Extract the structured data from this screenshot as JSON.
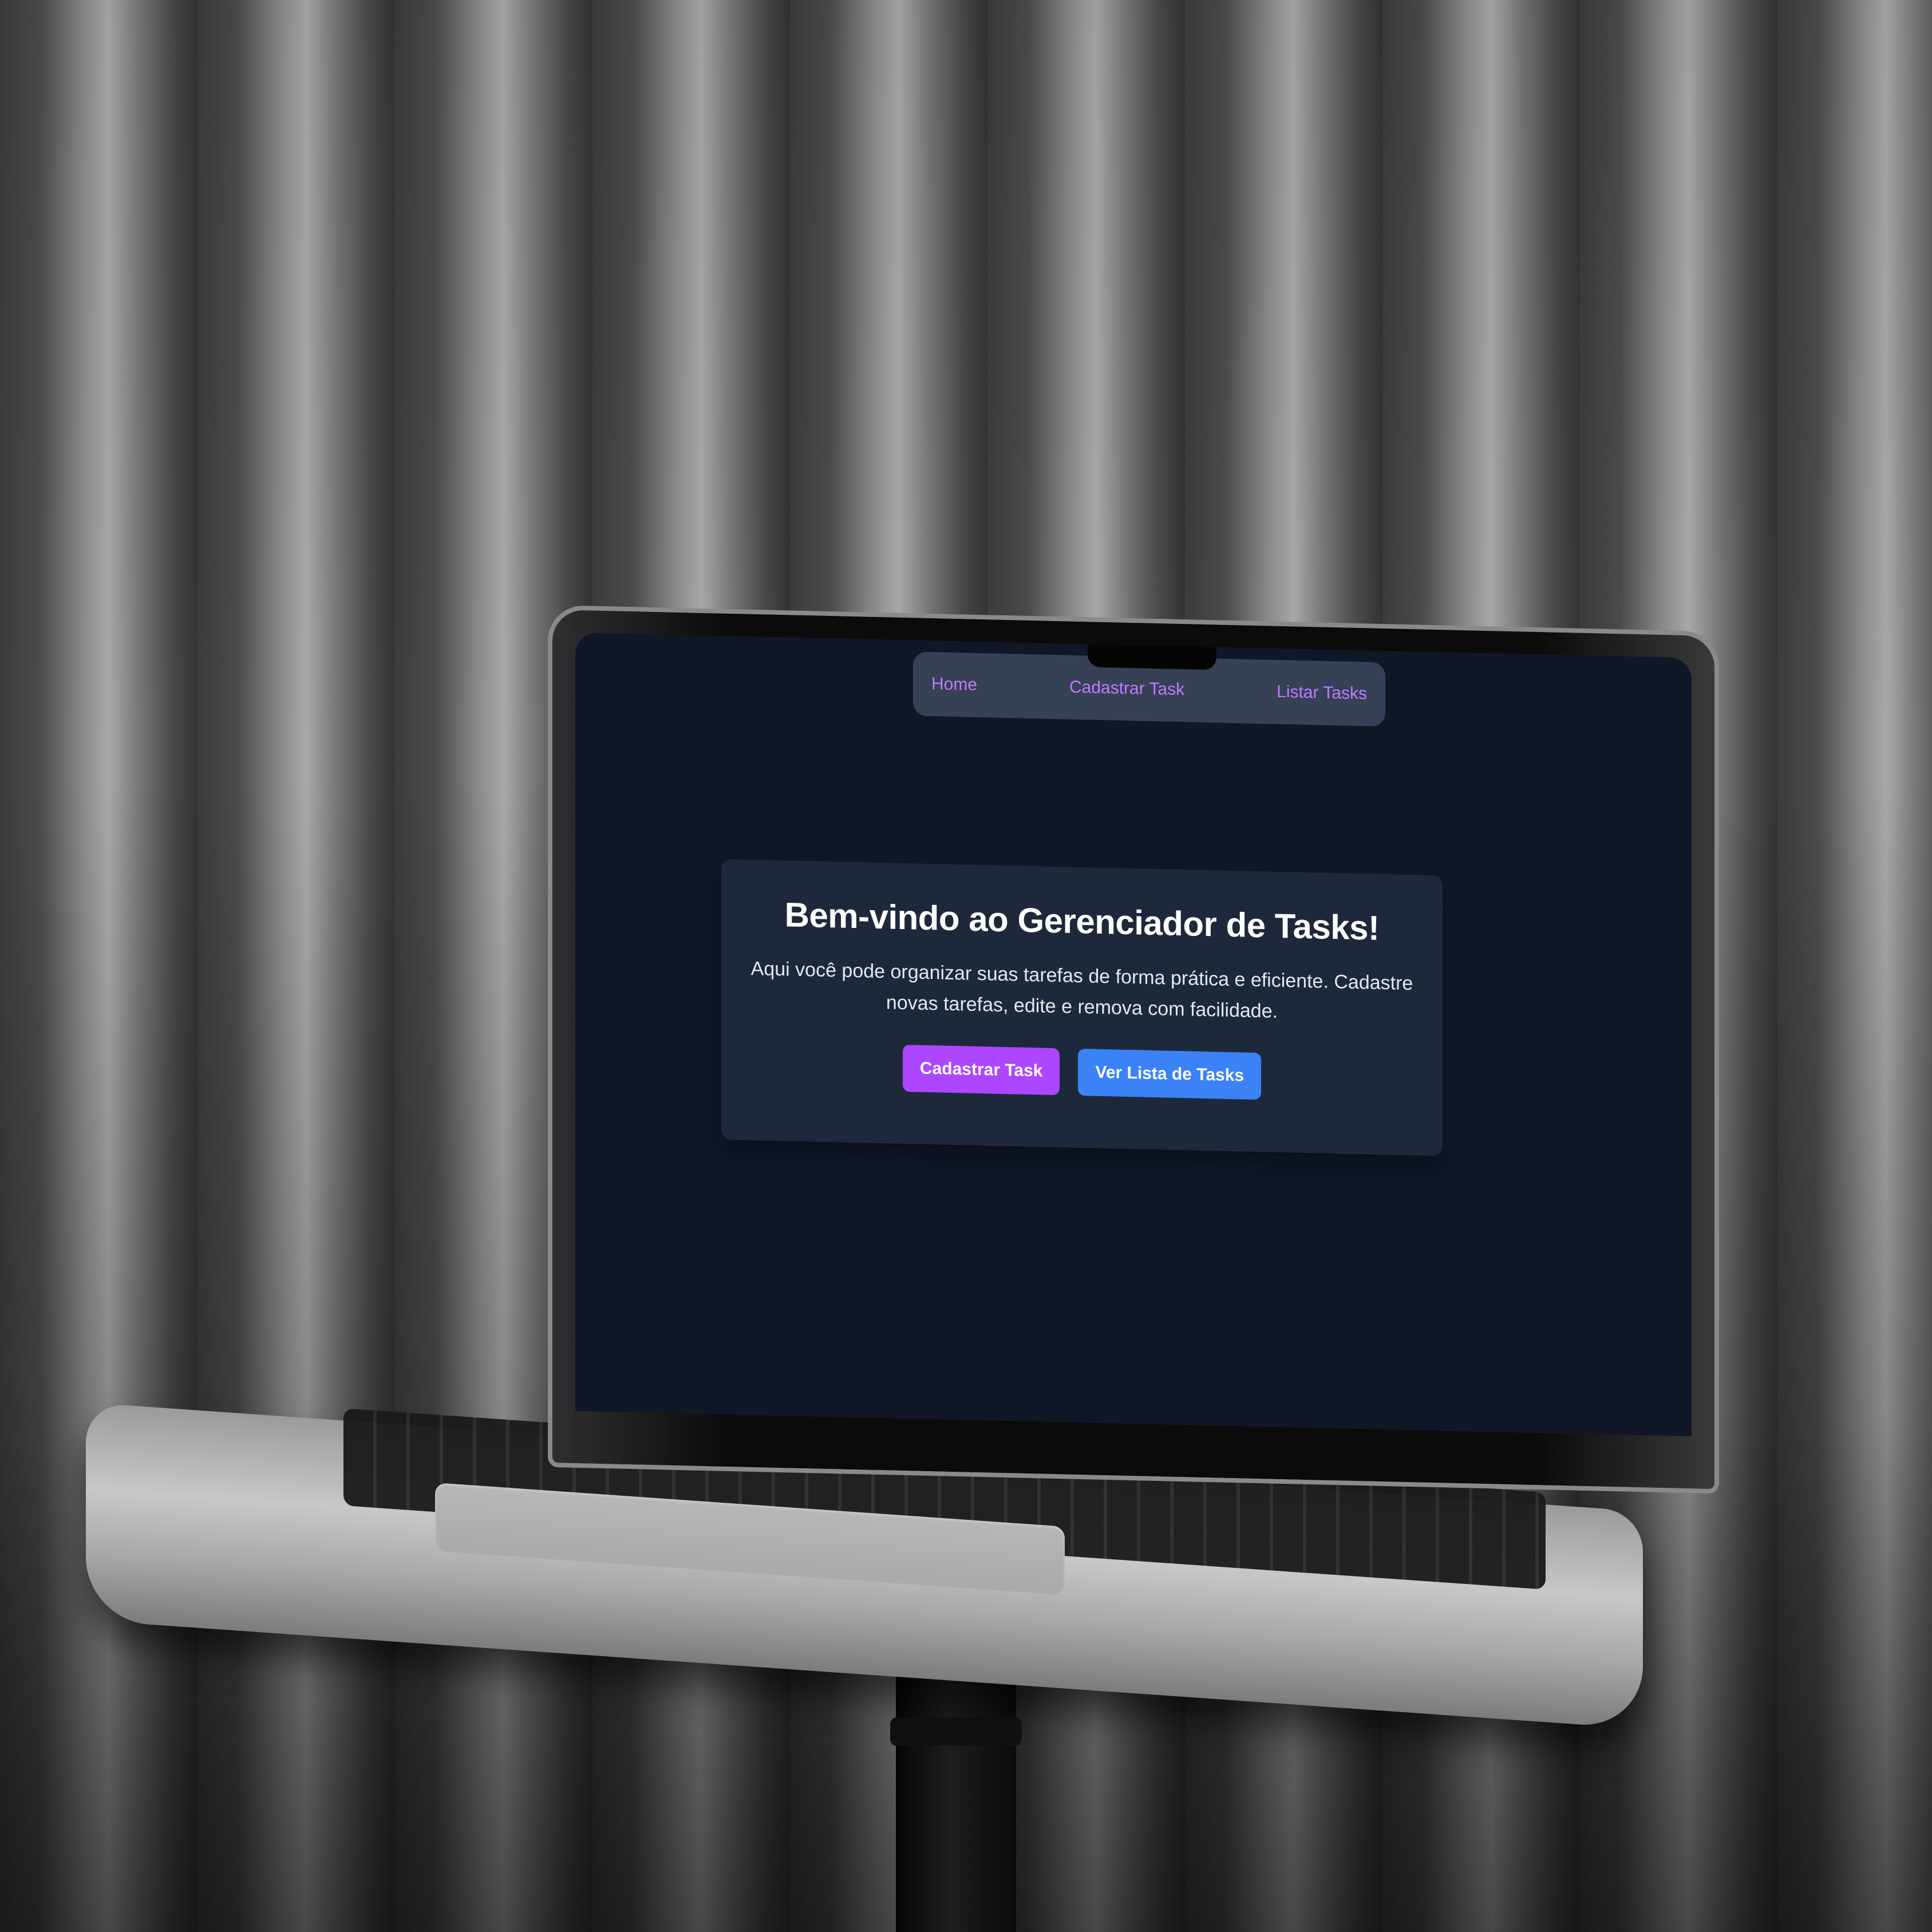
{
  "nav": {
    "items": [
      {
        "label": "Home"
      },
      {
        "label": "Cadastrar Task"
      },
      {
        "label": "Listar Tasks"
      }
    ]
  },
  "welcome": {
    "title": "Bem-vindo ao Gerenciador de Tasks!",
    "description": "Aqui você pode organizar suas tarefas de forma prática e eficiente. Cadastre novas tarefas, edite e remova com facilidade.",
    "primary_button": "Cadastrar Task",
    "secondary_button": "Ver Lista de Tasks"
  },
  "colors": {
    "screen_background": "#101828",
    "nav_background": "#364155",
    "nav_link": "#c27aff",
    "card_background": "#1d293b",
    "primary_button": "#ad46ff",
    "secondary_button": "#3b82f6"
  }
}
